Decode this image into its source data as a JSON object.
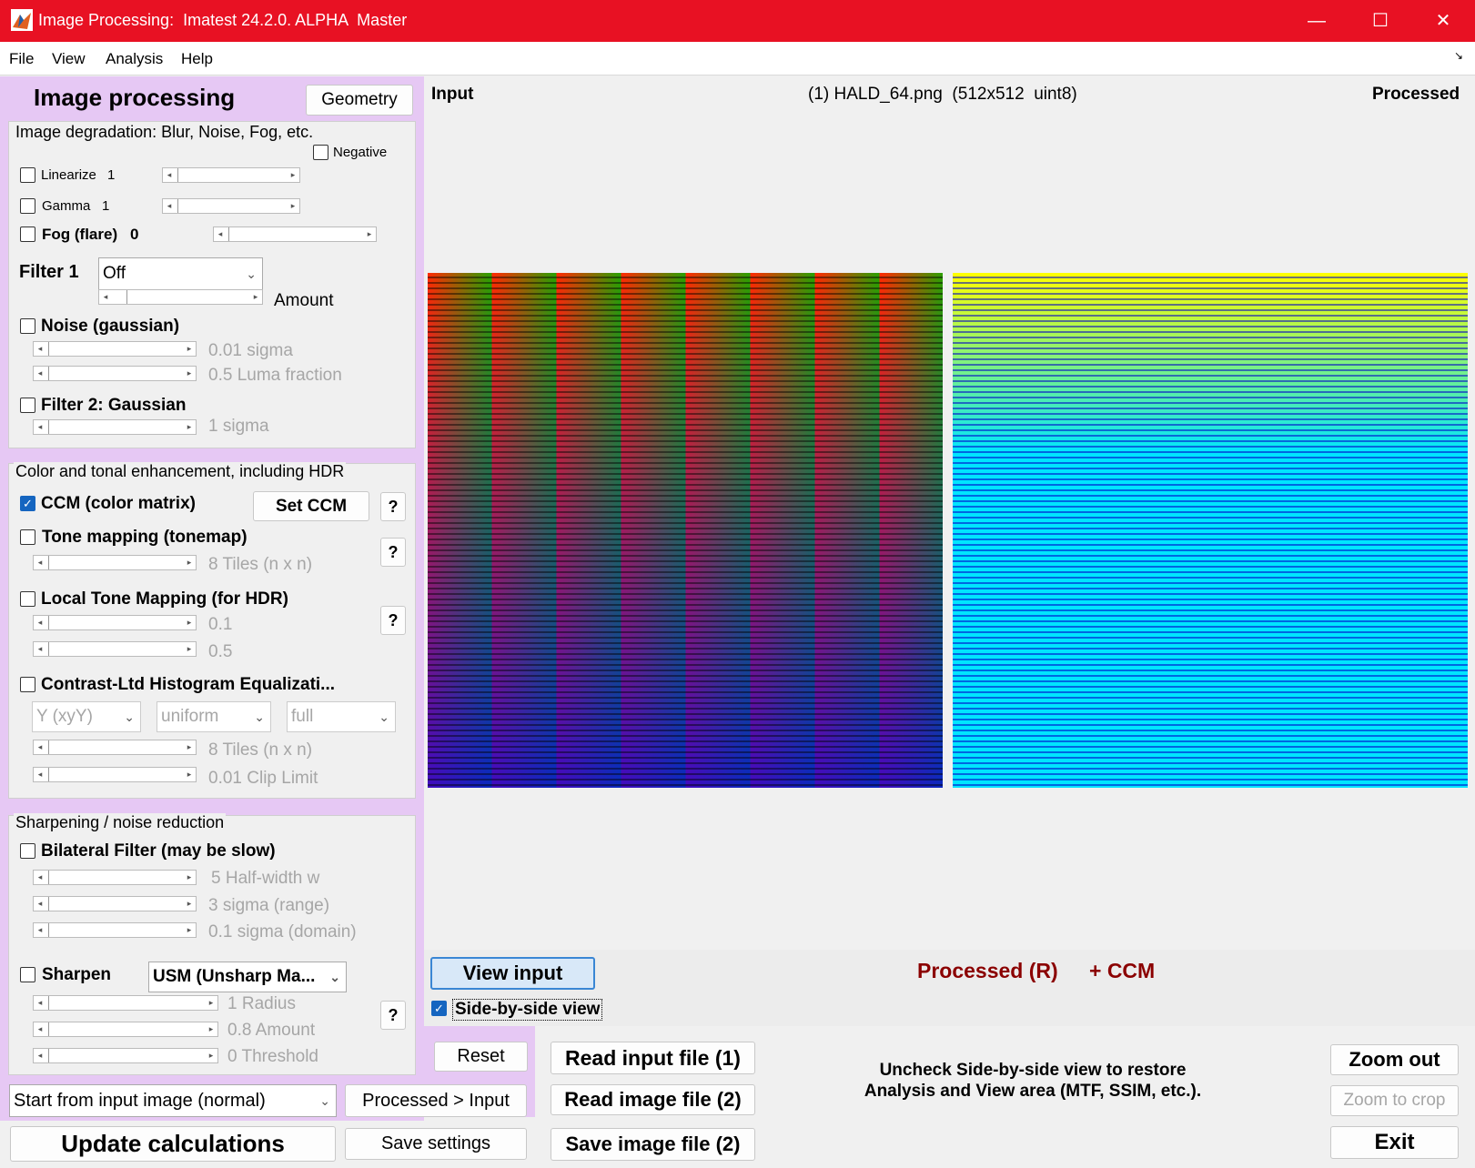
{
  "window": {
    "title": "Image Processing:  Imatest 24.2.0. ALPHA  Master",
    "minimize": "—",
    "maximize": "☐",
    "close": "✕"
  },
  "menu": [
    "File",
    "View",
    "Analysis",
    "Help"
  ],
  "left": {
    "heading": "Image processing",
    "geometry_button": "Geometry",
    "degradation": {
      "title": "Image degradation: Blur, Noise, Fog, etc.",
      "negative": "Negative",
      "linearize": "Linearize",
      "linearize_value": "1",
      "gamma": "Gamma",
      "gamma_value": "1",
      "fog": "Fog (flare)",
      "fog_value": "0",
      "filter1_label": "Filter 1",
      "filter1_value": "Off",
      "amount": "Amount",
      "noise": "Noise (gaussian)",
      "noise_sigma": "0.01  sigma",
      "noise_luma": "0.5  Luma fraction",
      "filter2": "Filter 2:  Gaussian",
      "filter2_sigma": "1  sigma"
    },
    "color": {
      "title": "Color and tonal enhancement, including HDR",
      "ccm": "CCM (color matrix)",
      "set_ccm": "Set CCM",
      "help": "?",
      "tonemap": "Tone mapping (tonemap)",
      "tonemap_tiles": "8  Tiles (n x n)",
      "local_tm": "Local Tone Mapping (for HDR)",
      "local_v1": "0.1",
      "local_v2": "0.5",
      "clahe": "Contrast-Ltd Histogram Equalizati...",
      "clahe_dd1": "Y (xyY)",
      "clahe_dd2": "uniform",
      "clahe_dd3": "full",
      "clahe_tiles": "8  Tiles (n x n)",
      "clahe_clip": "0.01  Clip Limit"
    },
    "sharpen": {
      "title": "Sharpening / noise reduction",
      "bilateral": "Bilateral Filter  (may be slow)",
      "bil_w": "5  Half-width w",
      "bil_range": "3  sigma (range)",
      "bil_domain": "0.1  sigma (domain)",
      "sharpen": "Sharpen",
      "sharpen_mode": "USM (Unsharp Ma...",
      "radius": "1  Radius",
      "amount": "0.8  Amount",
      "threshold": "0  Threshold"
    },
    "start_from": "Start from input image (normal)",
    "processed_input": "Processed > Input",
    "update": "Update calculations",
    "save_settings": "Save settings",
    "reset": "Reset"
  },
  "view": {
    "input_label": "Input",
    "file_label": "(1) HALD_64.png  (512x512  uint8)",
    "processed_label": "Processed",
    "view_input_button": "View input",
    "processed_status": "Processed (R)",
    "processed_ccm": "+ CCM",
    "side_by_side": "Side-by-side view"
  },
  "bottom": {
    "read_input": "Read input file (1)",
    "read_image": "Read image file (2)",
    "save_image": "Save image file (2)",
    "hint_line1": "Uncheck Side-by-side view to restore",
    "hint_line2": "Analysis and View area (MTF, SSIM, etc.).",
    "zoom_out": "Zoom out",
    "zoom_crop": "Zoom to crop",
    "exit": "Exit"
  },
  "colors": {
    "titlebar": "#e81123",
    "panel_lavender": "#e6c8f4",
    "status_red": "#8b0000"
  }
}
